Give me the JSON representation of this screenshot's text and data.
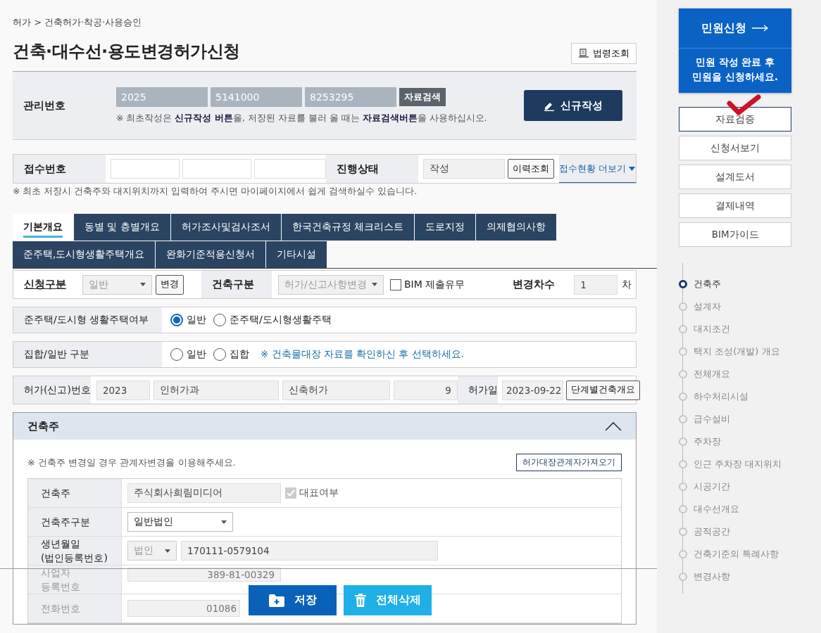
{
  "breadcrumb": "허가 > 건축허가·착공·사용승인",
  "title": "건축·대수선·용도변경허가신청",
  "law_button": "법령조회",
  "management": {
    "label": "관리번호",
    "numbers": [
      "2025",
      "5141000",
      "8253295"
    ],
    "search_button": "자료검색",
    "note": "※ 최초작성은 **신규작성 버튼**을, 저장된 자료를 불러 올 때는 **자료검색버튼**을 사용하십시오.",
    "new_button": "신규작성"
  },
  "receipt": {
    "label": "접수번호",
    "status_label": "진행상태",
    "status_value": "작성",
    "history_button": "이력조회",
    "more_link": "접수현황 더보기"
  },
  "receipt_note": "※ 최초 저장시 건축주와 대지위치까지 입력하여 주시면 마이페이지에서 쉽게 검색하실수 있습니다.",
  "tabs": [
    {
      "label": "기본개요",
      "selected": true
    },
    {
      "label": "동별 및 층별개요",
      "selected": false
    },
    {
      "label": "허가조사및검사조서",
      "selected": false
    },
    {
      "label": "한국건축규정 체크리스트",
      "selected": false
    },
    {
      "label": "도로지정",
      "selected": false
    },
    {
      "label": "의제협의사항",
      "selected": false
    },
    {
      "label": "준주택,도시형생활주택개요",
      "selected": false
    },
    {
      "label": "완화기준적용신청서",
      "selected": false
    },
    {
      "label": "기타시설",
      "selected": false
    }
  ],
  "application_row": {
    "type_label": "신청구분",
    "type_select": {
      "value": "일반",
      "disabled": true
    },
    "change_button": "변경",
    "building_label": "건축구분",
    "building_select": {
      "value": "허가/신고사항변경",
      "disabled": true
    },
    "bim": {
      "label": "BIM 제출유무",
      "checked": false
    },
    "revision_label": "변경차수",
    "revision_value": "1",
    "revision_unit": "차"
  },
  "housing_row": {
    "label": "준주택/도시형 생활주택여부",
    "options": [
      {
        "label": "일반",
        "selected": true
      },
      {
        "label": "준주택/도시형생활주택",
        "selected": false
      }
    ]
  },
  "collective_row": {
    "label": "집합/일반 구분",
    "options": [
      {
        "label": "일반",
        "selected": false
      },
      {
        "label": "집합",
        "selected": false
      }
    ],
    "note": "※ 건축물대장 자료를 확인하신 후 선택하세요."
  },
  "permit_row": {
    "label": "허가(신고)번호",
    "values": [
      "2023",
      "인허가과",
      "신축허가",
      "9"
    ],
    "date_label": "허가일",
    "date": "2023-09-22",
    "stage_button": "단계별건축개요"
  },
  "owner_section": {
    "title": "건축주",
    "expanded": true,
    "note": "※ 건축주 변경일 경우 관계자변경을 이용해주세요.",
    "import_button": "허가대장관계자가져오기",
    "rows": [
      {
        "kind": "text_check",
        "label": "건축주",
        "value": "주식회사희림미디어",
        "check_label": "대표여부",
        "checked": true
      },
      {
        "kind": "select",
        "label": "건축주구분",
        "select": {
          "value": "일반법인",
          "disabled": false
        }
      },
      {
        "kind": "select_text",
        "label": "생년월일\n(법인등록번호)",
        "select": {
          "value": "법인",
          "disabled": true
        },
        "value": "170111-0579104"
      },
      {
        "kind": "text_right",
        "label": "사업자\n등록번호",
        "value": "389-81-00329"
      },
      {
        "kind": "text_cut",
        "label": "전화번호",
        "value": "01086"
      }
    ]
  },
  "footer_buttons": [
    {
      "kind": "save",
      "label": "저장"
    },
    {
      "kind": "delete",
      "label": "전체삭제"
    }
  ],
  "apply_card": {
    "title": "민원신청",
    "note": "민원 작성 완료 후\n민원을 신청하세요."
  },
  "side_buttons": [
    {
      "label": "자료검증",
      "selected": true
    },
    {
      "label": "신청서보기",
      "selected": false
    },
    {
      "label": "설계도서",
      "selected": false
    },
    {
      "label": "결제내역",
      "selected": false
    },
    {
      "label": "BIM가이드",
      "selected": false
    }
  ],
  "steps": [
    {
      "label": "건축주",
      "selected": true
    },
    {
      "label": "설계자",
      "selected": false
    },
    {
      "label": "대지조건",
      "selected": false
    },
    {
      "label": "택지 조성(개발) 개요",
      "selected": false
    },
    {
      "label": "전체개요",
      "selected": false
    },
    {
      "label": "하수처리시설",
      "selected": false
    },
    {
      "label": "급수설비",
      "selected": false
    },
    {
      "label": "주차장",
      "selected": false
    },
    {
      "label": "인근 주차장 대지위치",
      "selected": false
    },
    {
      "label": "시공기간",
      "selected": false
    },
    {
      "label": "대수선개요",
      "selected": false
    },
    {
      "label": "공적공간",
      "selected": false
    },
    {
      "label": "건축기준의 특례사항",
      "selected": false
    },
    {
      "label": "변경사항",
      "selected": false
    }
  ]
}
